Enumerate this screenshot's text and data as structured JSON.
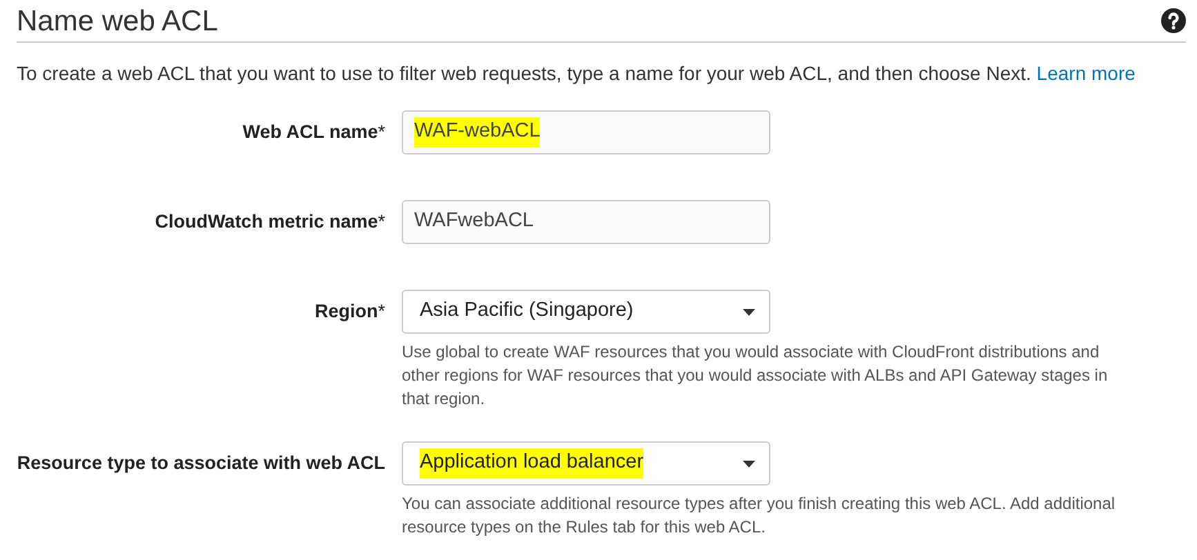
{
  "title": "Name web ACL",
  "intro": {
    "text": "To create a web ACL that you want to use to filter web requests, type a name for your web ACL, and then choose Next.",
    "link": "Learn more"
  },
  "fields": [
    {
      "kind": "text",
      "label": "Web ACL name",
      "required_mark": "*",
      "value": "WAF-webACL",
      "highlighted": true
    },
    {
      "kind": "text",
      "label": "CloudWatch metric name",
      "required_mark": "*",
      "value": "WAFwebACL",
      "highlighted": false
    },
    {
      "kind": "select",
      "label": "Region",
      "required_mark": "*",
      "value": "Asia Pacific (Singapore)",
      "highlighted": false,
      "help": "Use global to create WAF resources that you would associate with CloudFront distributions and other regions for WAF resources that you would associate with ALBs and API Gateway stages in that region."
    },
    {
      "kind": "select",
      "label": "Resource type to associate with web ACL",
      "value": "Application load balancer",
      "highlighted": true,
      "help": "You can associate additional resource types after you finish creating this web ACL. Add additional resource types on the Rules tab for this web ACL."
    }
  ]
}
